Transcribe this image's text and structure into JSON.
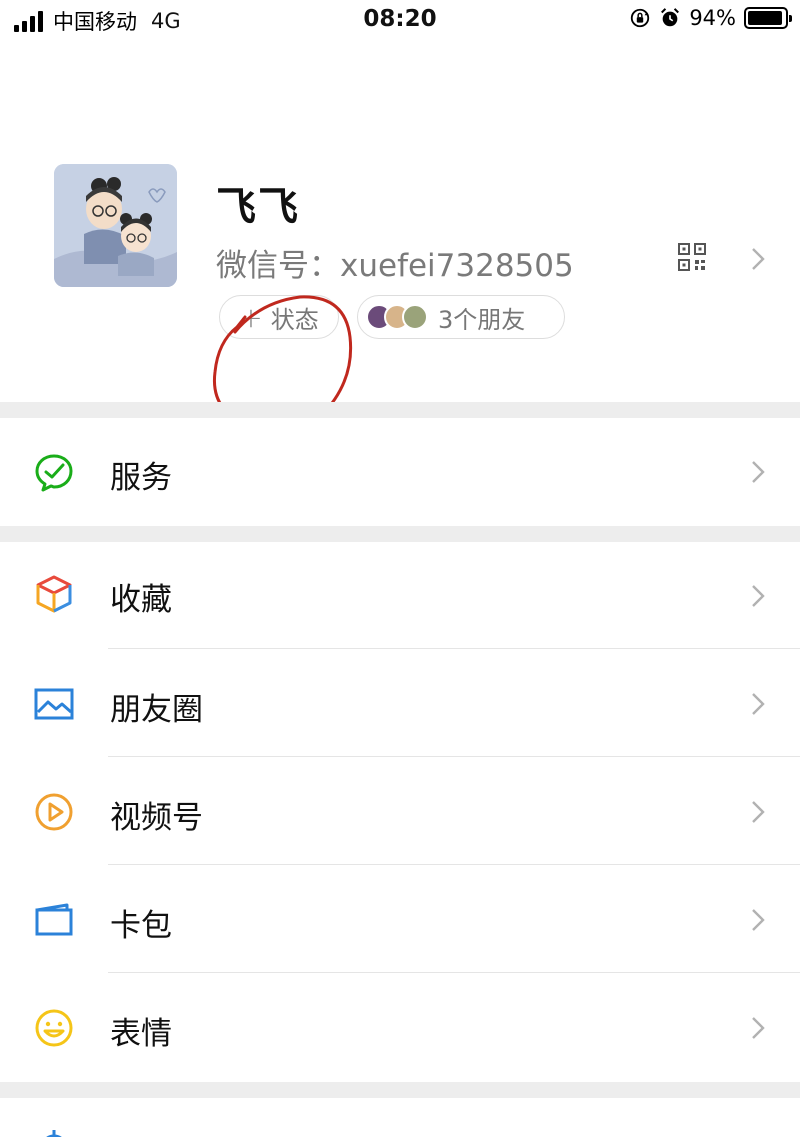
{
  "status_bar": {
    "carrier": "中国移动",
    "network": "4G",
    "time": "08:20",
    "battery": "94%",
    "battery_level": 0.94
  },
  "profile": {
    "nickname": "飞飞",
    "wechat_id": "微信号：xuefei7328505",
    "status_button": "状态",
    "status_plus": "+",
    "friends_label": "3个朋友"
  },
  "menu": {
    "services": {
      "label": "服务",
      "icon": "services-icon",
      "color": "#1aad19"
    },
    "favorites": {
      "label": "收藏",
      "icon": "favorites-cube-icon"
    },
    "moments": {
      "label": "朋友圈",
      "icon": "moments-image-icon",
      "color": "#2b82d9"
    },
    "channels": {
      "label": "视频号",
      "icon": "channels-play-icon",
      "color": "#f0a030"
    },
    "cards": {
      "label": "卡包",
      "icon": "card-wallet-icon",
      "color": "#2b82d9"
    },
    "stickers": {
      "label": "表情",
      "icon": "sticker-smile-icon",
      "color": "#f5c518"
    }
  },
  "annotation_color": "#c0281e"
}
